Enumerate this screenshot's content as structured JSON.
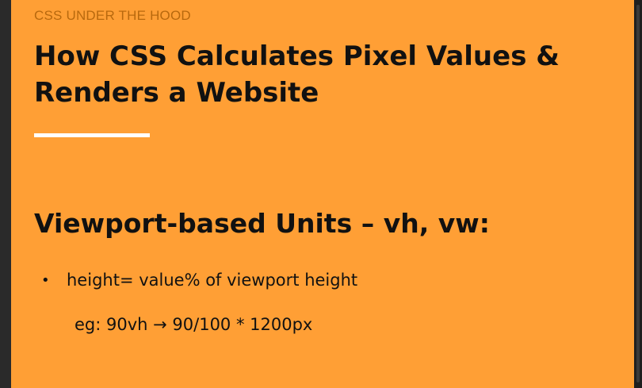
{
  "slide": {
    "eyebrow": "CSS UNDER THE HOOD",
    "title": "How CSS Calculates Pixel Values & Renders a Website",
    "section_heading": "Viewport-based Units – vh, vw:",
    "bullets": [
      {
        "text": "height= value% of viewport height"
      }
    ],
    "example": "eg: 90vh → 90/100 * 1200px"
  },
  "colors": {
    "slide_background": "#FF9F35",
    "eyebrow_text": "#B8690E",
    "heading_text": "#111111",
    "underline": "#FFFFFF",
    "viewer_background": "#232323"
  }
}
